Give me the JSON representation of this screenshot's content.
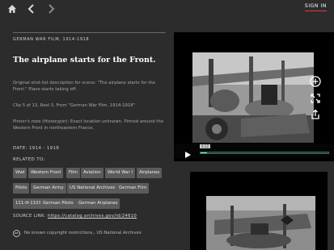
{
  "nav": {
    "sign_in": "SIGN IN"
  },
  "record": {
    "kicker": "GERMAN WAR FILM, 1914-1918",
    "title": "The airplane starts for the Front.",
    "paragraphs": [
      "Original shot-list description for scene: \"The airplane starts for the Front.\" Plane starts taking off.",
      "Clip 5 of 13, Reel 3. From \"German War Film, 1914-1918\"",
      "Pinner's note (Historypin): Exact location unknown. Pinned around the Western Front in northeastern France."
    ],
    "date_label": "DATE: 1914 - 1918",
    "related_label": "RELATED TO:",
    "tags": [
      [
        "WwI",
        "Western Front",
        "Film",
        "Aviation",
        "World War I",
        "Airplanes"
      ],
      [
        "Pilots",
        "German Army",
        "US National Archives",
        "German Film"
      ],
      [
        "111-H-1103",
        "German Pilots",
        "German Airplanes"
      ]
    ],
    "source_label": "SOURCE LINK:",
    "source_url": "https://catalog.archives.gov/id/24610",
    "license": "No known copyright restrictions., US National Archives",
    "license_badge": "cc"
  },
  "player": {
    "time": "0:12",
    "progress": 0.05
  },
  "colors": {
    "background": "#2c2c2c",
    "tag": "#5b5b5b",
    "accent": "#e23b3b"
  },
  "icons": [
    "home-icon",
    "back-arrow-icon",
    "forward-arrow-icon",
    "play-icon",
    "add-circle-icon",
    "fullscreen-icon",
    "share-icon"
  ]
}
